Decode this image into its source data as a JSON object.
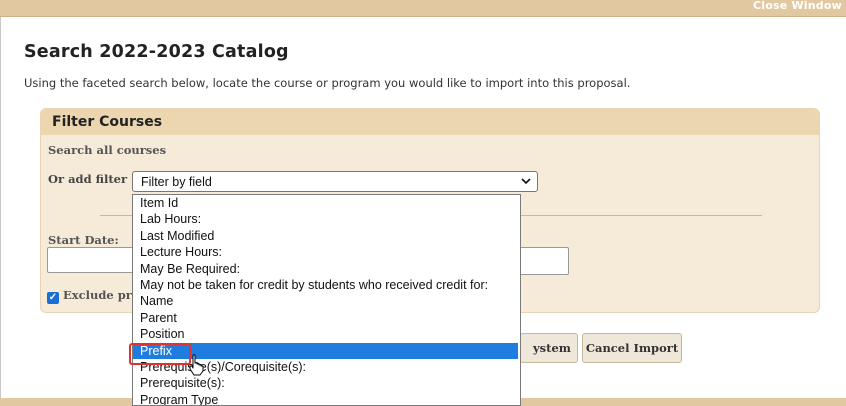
{
  "window": {
    "close_label": "Close Window"
  },
  "page": {
    "title": "Search 2022-2023 Catalog",
    "intro": "Using the faceted search below, locate the course or program you would like to import into this proposal."
  },
  "filter_panel": {
    "title": "Filter Courses",
    "search_all_label": "Search all courses",
    "add_filter_label": "Or add filter",
    "select_value": "Filter by field",
    "start_date_label": "Start Date:",
    "exclude_label": "Exclude pre",
    "exclude_checked": true
  },
  "buttons": {
    "import_system_partial": "ystem",
    "cancel_import": "Cancel Import"
  },
  "dropdown": {
    "options": [
      "Item Id",
      "Lab Hours:",
      "Last Modified",
      "Lecture Hours:",
      "May Be Required:",
      "May not be taken for credit by students who received credit for:",
      "Name",
      "Parent",
      "Position",
      "Prefix",
      "Prerequisite(s)/Corequisite(s):",
      "Prerequisite(s):",
      "Program Type"
    ],
    "selected_index": 9,
    "selected_label": "Prefix"
  },
  "colors": {
    "accent_bar": "#e2c8a0",
    "panel_bg": "#f6ead8",
    "selection": "#1f7de0",
    "highlight_box": "#e03030"
  }
}
